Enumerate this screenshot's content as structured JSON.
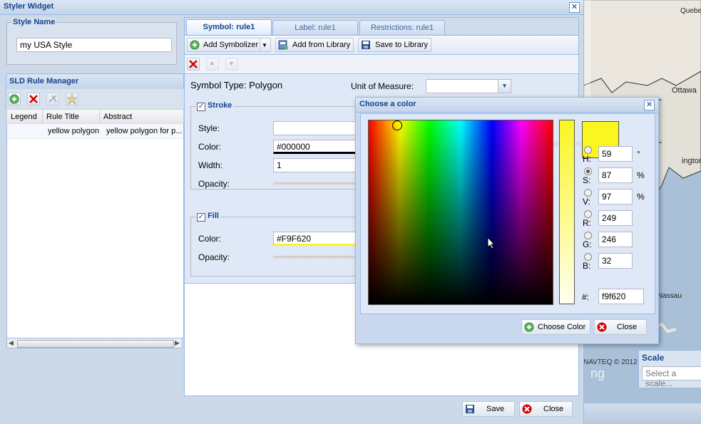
{
  "window": {
    "title": "Styler Widget"
  },
  "style_name": {
    "legend": "Style Name",
    "value": "my USA Style"
  },
  "rule_manager": {
    "title": "SLD Rule Manager",
    "columns": [
      "Legend",
      "Rule Title",
      "Abstract"
    ],
    "rows": [
      {
        "legend": "",
        "title": "yellow polygon",
        "abstract": "yellow polygon for p..."
      }
    ]
  },
  "tabs": [
    {
      "label": "Symbol: rule1",
      "active": true
    },
    {
      "label": "Label: rule1",
      "active": false
    },
    {
      "label": "Restrictions: rule1",
      "active": false
    }
  ],
  "toolbar": {
    "add_symbolizer": "Add Symbolizer",
    "add_from_library": "Add from Library",
    "save_to_library": "Save to Library"
  },
  "symbol": {
    "type_label": "Symbol Type: Polygon",
    "unit_label": "Unit of Measure:",
    "unit_value": ""
  },
  "stroke": {
    "legend": "Stroke",
    "checked": true,
    "style_label": "Style:",
    "color_label": "Color:",
    "color_value": "#000000",
    "width_label": "Width:",
    "width_value": "1",
    "opacity_label": "Opacity:"
  },
  "fill": {
    "legend": "Fill",
    "checked": true,
    "color_label": "Color:",
    "color_value": "#F9F620",
    "opacity_label": "Opacity:"
  },
  "color_dialog": {
    "title": "Choose a color",
    "swatch": "#f9f620",
    "fields": [
      {
        "key": "H",
        "label": "H:",
        "value": "59",
        "unit": "°",
        "checked": false
      },
      {
        "key": "S",
        "label": "S:",
        "value": "87",
        "unit": "%",
        "checked": true
      },
      {
        "key": "V",
        "label": "V:",
        "value": "97",
        "unit": "%",
        "checked": false
      },
      {
        "key": "R",
        "label": "R:",
        "value": "249",
        "unit": "",
        "checked": false
      },
      {
        "key": "G",
        "label": "G:",
        "value": "246",
        "unit": "",
        "checked": false
      },
      {
        "key": "B",
        "label": "B:",
        "value": "32",
        "unit": "",
        "checked": false
      }
    ],
    "hex_label": "#:",
    "hex_value": "f9f620",
    "choose_label": "Choose Color",
    "close_label": "Close"
  },
  "footer": {
    "save_label": "Save",
    "close_label": "Close"
  },
  "map": {
    "labels": [
      "Quebec",
      "Ottawa",
      "ington",
      "Nassau"
    ],
    "copyright": "NAVTEQ © 2012",
    "scale_title": "Scale",
    "scale_placeholder": "Select a scale..."
  },
  "colors": {
    "accent": "#15428b",
    "fill": "#F9F620",
    "delete": "#d40000"
  }
}
